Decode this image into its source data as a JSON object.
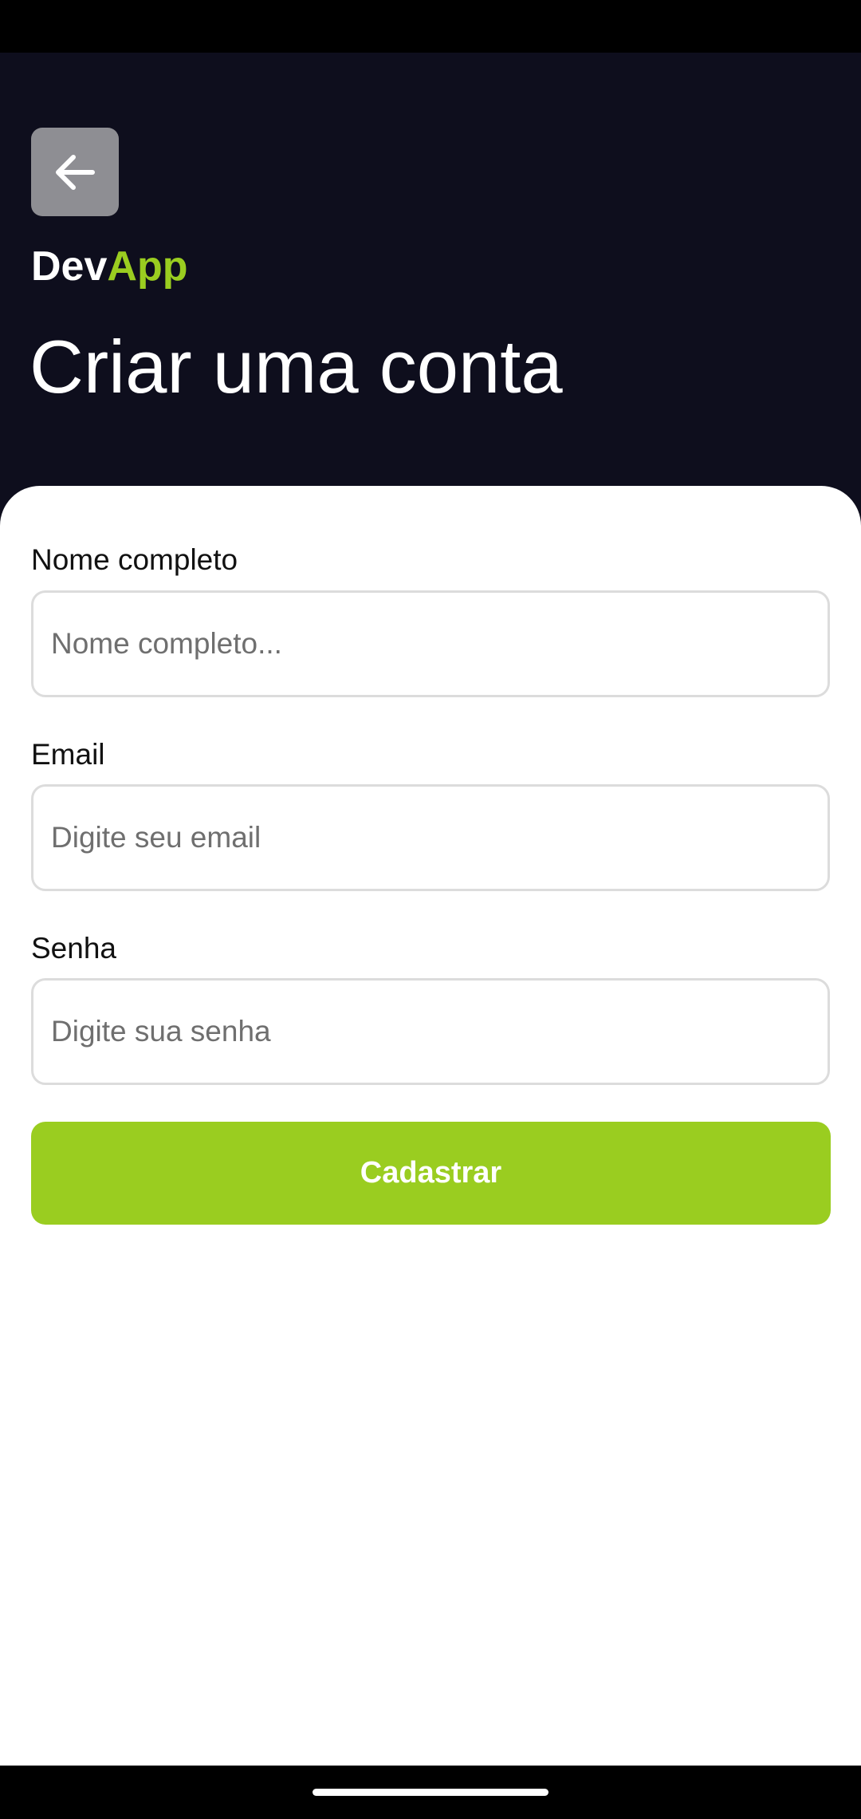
{
  "header": {
    "back_icon": "arrow-left-icon",
    "brand_primary": "Dev",
    "brand_accent": "App",
    "title": "Criar uma conta"
  },
  "form": {
    "name": {
      "label": "Nome completo",
      "placeholder": "Nome completo...",
      "value": ""
    },
    "email": {
      "label": "Email",
      "placeholder": "Digite seu email",
      "value": ""
    },
    "password": {
      "label": "Senha",
      "placeholder": "Digite sua senha",
      "value": ""
    },
    "submit_label": "Cadastrar"
  },
  "colors": {
    "header_background": "#0e0e1d",
    "accent": "#9acd20",
    "back_button": "#8e8e93",
    "card_background": "#ffffff"
  }
}
